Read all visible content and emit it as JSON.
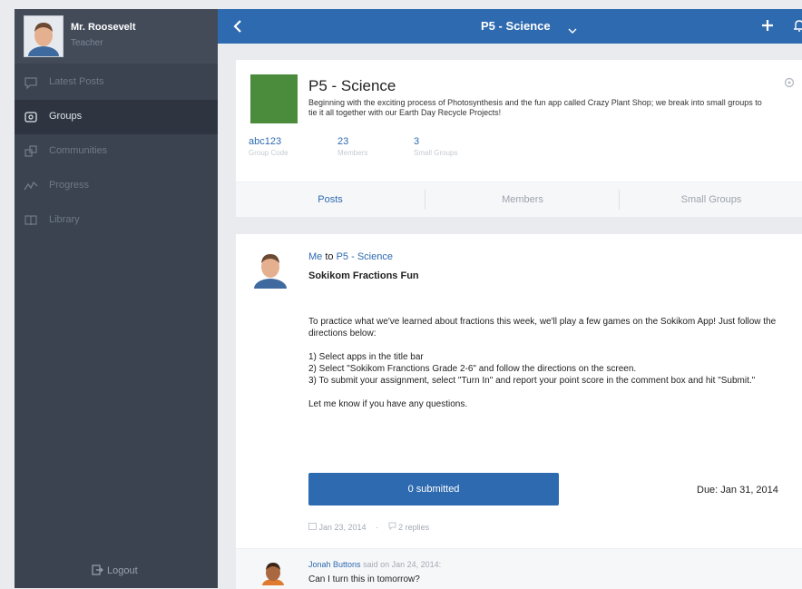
{
  "profile": {
    "name": "Mr. Roosevelt",
    "role": "Teacher"
  },
  "sidebar": {
    "items": [
      {
        "label": "Latest Posts",
        "icon": "speech-bubble-icon"
      },
      {
        "label": "Groups",
        "icon": "groups-icon",
        "active": true
      },
      {
        "label": "Communities",
        "icon": "communities-icon"
      },
      {
        "label": "Progress",
        "icon": "progress-icon"
      },
      {
        "label": "Library",
        "icon": "library-icon"
      }
    ],
    "logout_label": "Logout"
  },
  "topbar": {
    "title": "P5 - Science"
  },
  "group": {
    "name": "P5 - Science",
    "description": "Beginning with the exciting process of Photosynthesis and the fun app called Crazy Plant Shop; we break into small groups to tie it all together with our Earth Day Recycle Projects!",
    "stats": [
      {
        "value": "abc123",
        "label": "Group Code"
      },
      {
        "value": "23",
        "label": "Members"
      },
      {
        "value": "3",
        "label": "Small Groups"
      }
    ],
    "tabs": [
      "Posts",
      "Members",
      "Small Groups"
    ],
    "thumb_color": "#4a8c3b"
  },
  "post": {
    "author": "Me",
    "to_word": "to",
    "target": "P5 - Science",
    "title": "Sokikom Fractions Fun",
    "body": [
      "To practice what we've learned about fractions this week, we'll play a few games on the Sokikom App! Just follow the directions below:",
      "1) Select apps in the title bar",
      "2) Select \"Sokikom Franctions Grade 2-6\" and follow the directions on the screen.",
      "3) To submit your assignment, select \"Turn In\" and report your point score in the comment box and hit \"Submit.\"",
      "Let me know if you have any questions."
    ],
    "submit_label": "0 submitted",
    "due": "Due: Jan 31, 2014",
    "date": "Jan 23, 2014",
    "replies": "2 replies"
  },
  "comment": {
    "author": "Jonah Buttons",
    "said_on": "said on Jan 24, 2014:",
    "text": "Can I turn this in tomorrow?"
  },
  "colors": {
    "accent": "#2e6ab0",
    "sidebar": "#3b4350",
    "active_nav": "#2e3541"
  }
}
